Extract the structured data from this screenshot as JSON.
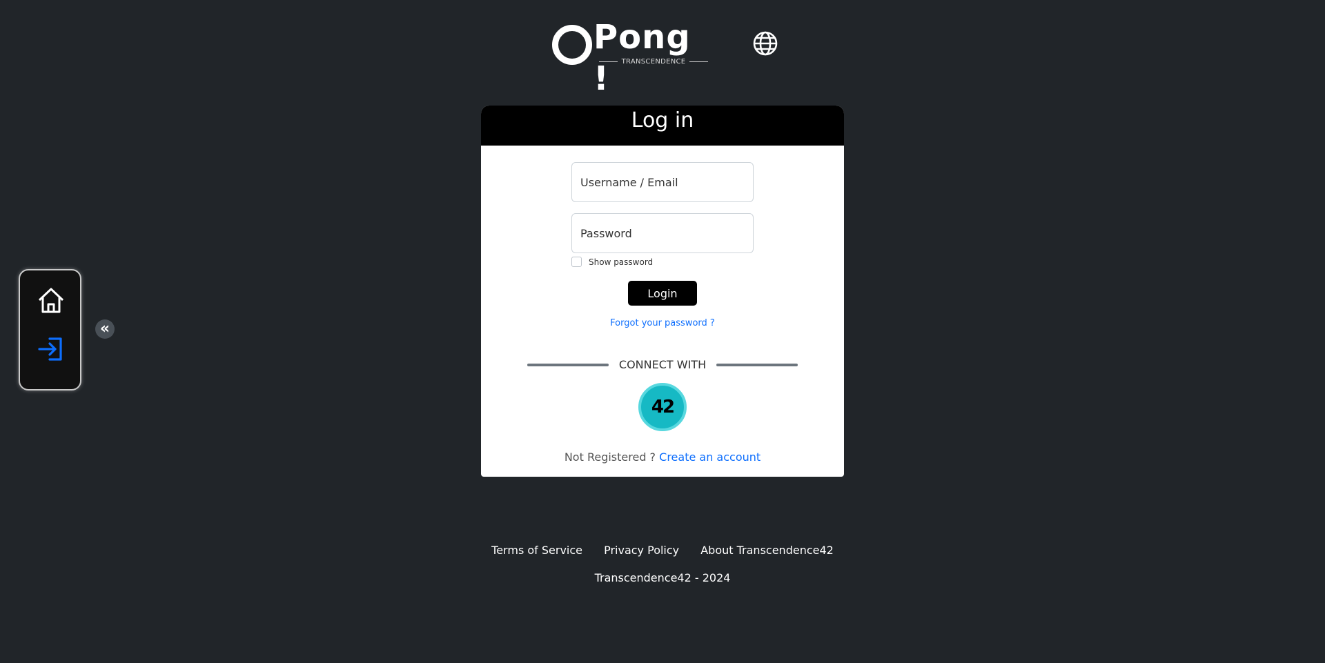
{
  "header": {
    "logo_text": "Pong !",
    "logo_subtitle": "TRANSCENDENCE"
  },
  "card": {
    "title": "Log in",
    "username_placeholder": "Username / Email",
    "password_placeholder": "Password",
    "show_password_label": "Show password",
    "login_label": "Login",
    "forgot_label": "Forgot your password ?",
    "connect_with_label": "CONNECT WITH",
    "ft_label": "42",
    "not_registered": "Not Registered ?",
    "create_account": "Create an account"
  },
  "sidenav": {
    "collapse_label": "«"
  },
  "footer": {
    "links": [
      "Terms of Service",
      "Privacy Policy",
      "About Transcendence42"
    ],
    "copyright": "Transcendence42 - 2024"
  },
  "colors": {
    "background": "#212529",
    "accent": "#0d6efd",
    "ft_teal": "#16b9c4"
  }
}
